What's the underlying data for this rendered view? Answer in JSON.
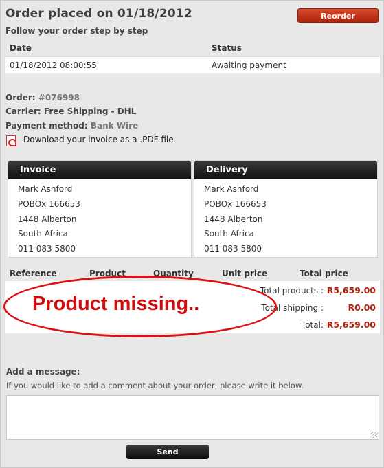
{
  "header": {
    "title": "Order placed on 01/18/2012",
    "reorder_label": "Reorder",
    "subtitle": "Follow your order step by step"
  },
  "history": {
    "columns": [
      "Date",
      "Status"
    ],
    "rows": [
      {
        "date": "01/18/2012 08:00:55",
        "status": "Awaiting payment"
      }
    ]
  },
  "order_info": {
    "order_label": "Order:",
    "order_value": "#076998",
    "carrier_label": "Carrier:",
    "carrier_value": "Free Shipping - DHL",
    "payment_label": "Payment method:",
    "payment_value": "Bank Wire",
    "invoice_link": "Download your invoice as a .PDF file",
    "invoice_icon": "pdf-icon"
  },
  "invoice": {
    "heading": "Invoice",
    "lines": [
      "Mark Ashford",
      "POBOx 166653",
      "1448 Alberton",
      "South Africa",
      "011 083 5800"
    ]
  },
  "delivery": {
    "heading": "Delivery",
    "lines": [
      "Mark Ashford",
      "POBOx 166653",
      "1448 Alberton",
      "South Africa",
      "011 083 5800"
    ]
  },
  "products": {
    "columns": [
      "Reference",
      "Product",
      "Quantity",
      "Unit price",
      "Total price"
    ],
    "total_products_label": "Total products :",
    "total_products_value": "R5,659.00",
    "total_shipping_label": "Total shipping :",
    "total_shipping_value": "R0.00",
    "total_label": "Total:",
    "total_value": "R5,659.00"
  },
  "annotation": {
    "text": "Product missing..",
    "color": "#d10c0c"
  },
  "message": {
    "label": "Add a message:",
    "hint": "If you would like to add a comment about your order, please write it below.",
    "value": "",
    "send_label": "Send"
  },
  "colors": {
    "accent_red": "#b2200c",
    "header_dark": "#111111",
    "background": "#e8e8e8"
  }
}
